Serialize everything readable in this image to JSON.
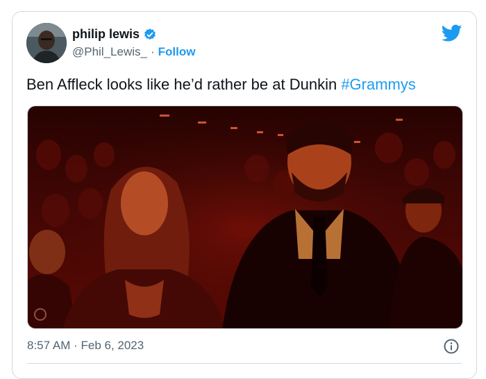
{
  "author": {
    "name": "philip lewis",
    "handle": "@Phil_Lewis_",
    "separator": "·",
    "follow_label": "Follow",
    "verified": true
  },
  "tweet": {
    "text": "Ben Affleck looks like he’d rather be at Dunkin ",
    "hashtag": "#Grammys"
  },
  "media": {
    "description_icon": "photo"
  },
  "footer": {
    "timestamp": "8:57 AM · Feb 6, 2023"
  },
  "icons": {
    "brand": "twitter-bird-icon",
    "verified": "verified-badge-icon",
    "info": "info-icon"
  },
  "colors": {
    "accent": "#1d9bf0",
    "text": "#0f1419",
    "muted": "#536471",
    "border": "#cfd9de"
  }
}
